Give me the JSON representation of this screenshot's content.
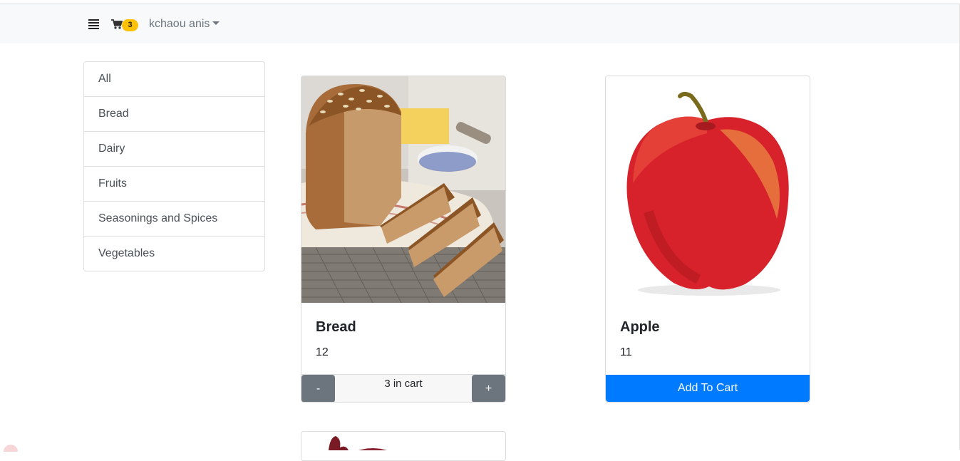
{
  "navbar": {
    "menu_icon": "list-icon",
    "cart_icon": "shopping-cart-icon",
    "cart_count": "3",
    "user_name": "kchaou anis"
  },
  "categories": [
    "All",
    "Bread",
    "Dairy",
    "Fruits",
    "Seasonings and Spices",
    "Vegetables"
  ],
  "products": [
    {
      "title": "Bread",
      "price": "12",
      "qty_minus": "-",
      "qty_label": "3 in cart",
      "qty_plus": "+"
    },
    {
      "title": "Apple",
      "price": "11",
      "add_label": "Add To Cart"
    }
  ],
  "colors": {
    "primary": "#007bff",
    "secondary": "#6c757d",
    "badge": "#ffc107",
    "navbar_bg": "#f8f9fa"
  }
}
